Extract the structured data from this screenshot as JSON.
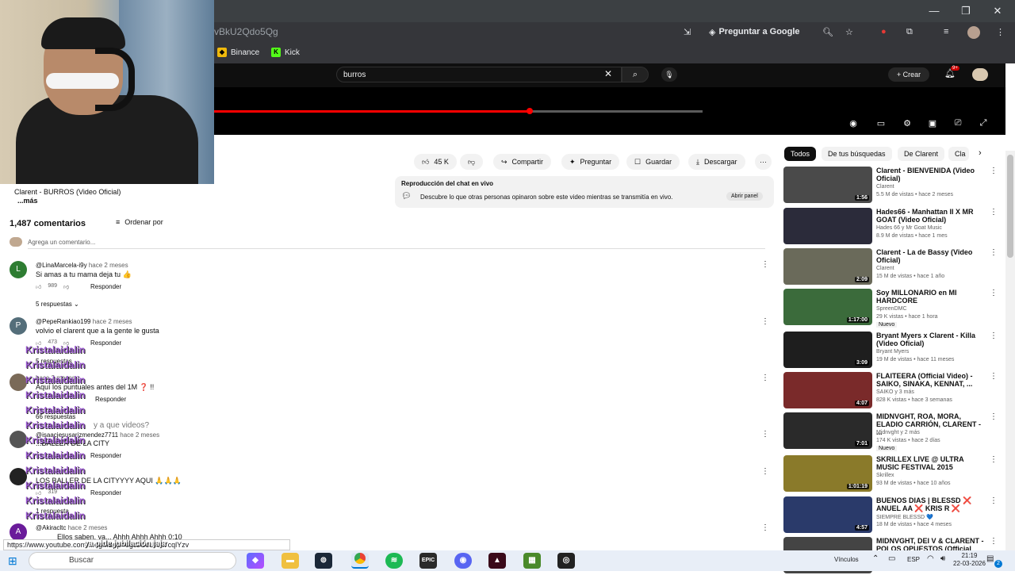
{
  "browser": {
    "url": "vBkU2Qdo5Qg",
    "ask_google": "Preguntar a Google",
    "bookmarks": [
      "Binance",
      "Kick"
    ],
    "window_controls": [
      "minimize-icon",
      "restore-icon",
      "close-icon"
    ]
  },
  "youtube": {
    "search_value": "burros",
    "create_label": "Crear",
    "notif_count": "9+",
    "actions": {
      "likes": "45 K",
      "share": "Compartir",
      "ask": "Preguntar",
      "save": "Guardar",
      "download": "Descargar"
    },
    "description": {
      "line1": "Clarent - BURROS (Video Oficial)",
      "more": "...más"
    },
    "live_chat": {
      "title": "Reproducción del chat en vivo",
      "text": "Descubre lo que otras personas opinaron sobre este video mientras se transmitía en vivo.",
      "button": "Abrir panel"
    },
    "comments_header": {
      "count": "1,487 comentarios",
      "sort": "Ordenar por",
      "add_placeholder": "Agrega un comentario..."
    },
    "comments": [
      {
        "avatar": "L",
        "color": "#2e7d32",
        "handle": "@LinaMarcela-i9y",
        "time": "hace 2 meses",
        "text": "Si amas a tu mama deja tu 👍",
        "likes": "989",
        "reply": "Responder",
        "replies": "5 respuestas"
      },
      {
        "avatar": "P",
        "color": "#546e7a",
        "handle": "@PepeRankiao199",
        "time": "hace 2 meses",
        "text": "volvio el clarent que a la gente le gusta",
        "likes": "473",
        "reply": "Responder",
        "replies": "5 respuestas"
      },
      {
        "avatar": "",
        "color": "#7a6a58",
        "handle": "@...",
        "time": "hace 2 meses",
        "text": "Aquí los puntuales antes del 1M ❓ !!",
        "likes": "",
        "reply": "Responder",
        "replies": "66 respuestas"
      },
      {
        "avatar": "",
        "color": "#555555",
        "handle": "@isaacjesusarizmendez7711",
        "time": "hace 2 meses",
        "text": "...BALLER DE LA CITY",
        "likes": "",
        "reply": "Responder",
        "replies": ""
      },
      {
        "avatar": "",
        "color": "#222222",
        "handle": "",
        "time": "",
        "text": "LOS BALLER DE LA CITYYYY AQUI 🙏🙏🙏",
        "likes": "319",
        "reply": "Responder",
        "replies": "1 respuesta"
      },
      {
        "avatar": "A",
        "color": "#6a1b9a",
        "handle": "@Akiracltc",
        "time": "hace 2 meses",
        "text": "Ellos saben, ya... Ahhh Ahhh Ahhh 0:10",
        "likes": "",
        "reply": "",
        "replies": ""
      }
    ],
    "overlay_chat": {
      "name": "Kristalaidalin",
      "messages": [
        "",
        "",
        "",
        "...",
        "",
        "y a que videos?",
        "",
        "",
        "",
        "",
        "",
        "",
        "",
        "",
        "",
        "ya pide jubilación jaja"
      ]
    },
    "chips": [
      "Todos",
      "De tus búsquedas",
      "De Clarent",
      "Cla"
    ],
    "recommendations": [
      {
        "title": "Clarent - BIENVENIDA (Video Oficial)",
        "channel": "Clarent",
        "meta": "5.5 M de vistas • hace 2 meses",
        "duration": "1:56",
        "badge": "",
        "thumb": "#4a4a4a"
      },
      {
        "title": "Hades66 - Manhattan II X MR GOAT (Video Oficial)",
        "channel": "Hades 66 y Mr Goat Music",
        "meta": "8.9 M de vistas • hace 1 mes",
        "duration": "",
        "badge": "",
        "thumb": "#2b2b3a"
      },
      {
        "title": "Clarent - La de Bassy (Video Oficial)",
        "channel": "Clarent",
        "meta": "15 M de vistas • hace 1 año",
        "duration": "2:09",
        "badge": "",
        "thumb": "#6a6a5a"
      },
      {
        "title": "Soy MILLONARIO en MI HARDCORE",
        "channel": "SpreenDMC",
        "meta": "29 K vistas • hace 1 hora",
        "duration": "1:17:00",
        "badge": "Nuevo",
        "thumb": "#3b6b3b"
      },
      {
        "title": "Bryant Myers x Clarent - Killa (Video Oficial)",
        "channel": "Bryant Myers",
        "meta": "19 M de vistas • hace 11 meses",
        "duration": "3:09",
        "badge": "",
        "thumb": "#1e1e1e"
      },
      {
        "title": "FLAITEERA (Official Video) - SAIKO, SINAKA, KENNAT, ...",
        "channel": "SAIKO y 3 más",
        "meta": "828 K vistas • hace 3 semanas",
        "duration": "4:07",
        "badge": "",
        "thumb": "#7a2a2a"
      },
      {
        "title": "MIDNVGHT, ROA, MORA, ELADIO CARRIÓN, CLARENT - ...",
        "channel": "Midnvght y 2 más",
        "meta": "174 K vistas • hace 2 días",
        "duration": "7:01",
        "badge": "Nuevo",
        "thumb": "#2a2a2a"
      },
      {
        "title": "SKRILLEX LIVE @ ULTRA MUSIC FESTIVAL 2015",
        "channel": "Skrillex",
        "meta": "93 M de vistas • hace 10 años",
        "duration": "1:01:19",
        "badge": "",
        "thumb": "#8a7a2a"
      },
      {
        "title": "BUENOS DIAS | BLESSD ❌ ANUEL AA ❌ KRIS R ❌",
        "channel": "SIEMPRE BLESSD 💙",
        "meta": "18 M de vistas • hace 4 meses",
        "duration": "4:57",
        "badge": "",
        "thumb": "#2a3a6a"
      },
      {
        "title": "MIDNVGHT, DEI V & CLARENT - POLOS OPUESTOS (Official",
        "channel": "",
        "meta": "",
        "duration": "",
        "badge": "",
        "thumb": "#444444"
      }
    ]
  },
  "status_bar": {
    "url": "https://www.youtube.com/...egM&pp=0gcJCcUKAYcqlYzv",
    "overlay_bold": "ya pide jubilación jaja"
  },
  "taskbar": {
    "search_label": "Buscar",
    "links_label": "Vínculos",
    "lang": "ESP",
    "time": "21:19",
    "date": "22-03-2026",
    "notif": "2"
  }
}
